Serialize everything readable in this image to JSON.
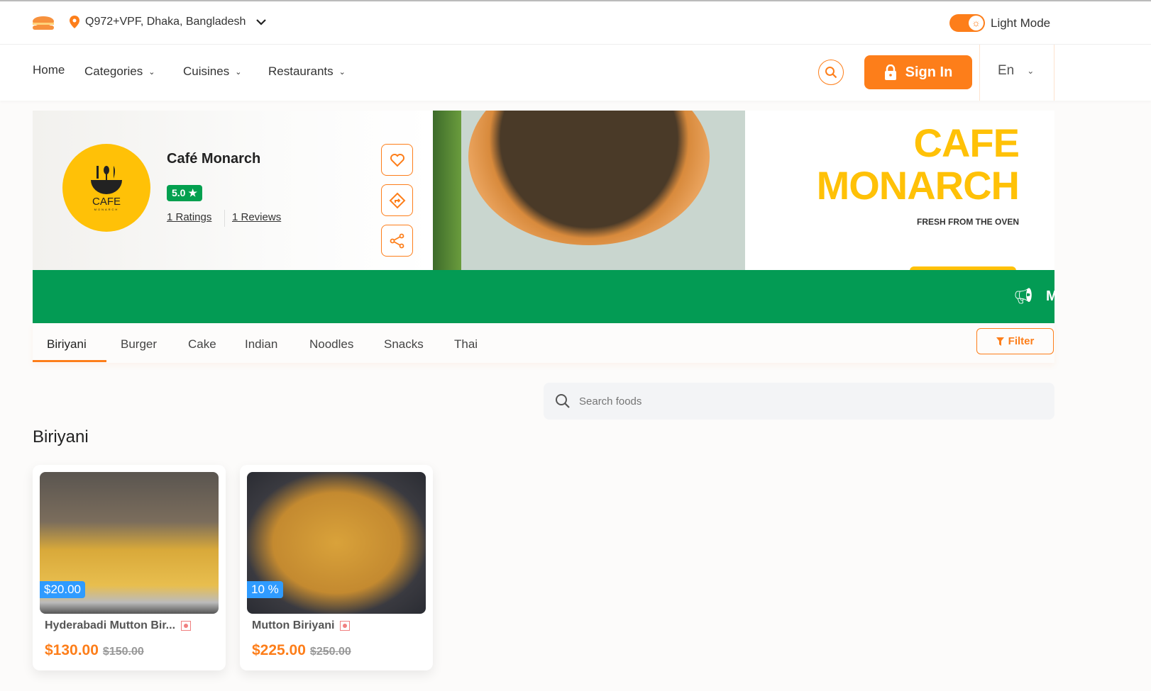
{
  "topbar": {
    "location": "Q972+VPF, Dhaka, Bangladesh",
    "theme_label": "Light Mode",
    "theme_on": true
  },
  "nav": {
    "home": "Home",
    "categories": "Categories",
    "cuisines": "Cuisines",
    "restaurants": "Restaurants",
    "sign_in": "Sign In",
    "language": "En"
  },
  "restaurant": {
    "name": "Café Monarch",
    "rating": "5.0 ★",
    "ratings_link": "1 Ratings",
    "reviews_link": "1 Reviews",
    "logo_text": "CAFE",
    "logo_subtext": "MONARCH"
  },
  "cover": {
    "title_line1": "CAFE",
    "title_line2": "MONARCH",
    "tagline": "FRESH FROM THE OVEN",
    "ticker": "M"
  },
  "tabs": [
    "Biriyani",
    "Burger",
    "Cake",
    "Indian",
    "Noodles",
    "Snacks",
    "Thai"
  ],
  "active_tab": "Biriyani",
  "filter_label": "Filter",
  "search": {
    "placeholder": "Search foods"
  },
  "section_title": "Biriyani",
  "foods": [
    {
      "name": "Hyderabadi Mutton Bir...",
      "badge": "$20.00",
      "price": "$130.00",
      "old_price": "$150.00"
    },
    {
      "name": "Mutton Biriyani",
      "badge": "10 %",
      "price": "$225.00",
      "old_price": "$250.00"
    }
  ],
  "colors": {
    "accent": "#fd7e1a",
    "green": "#039b54",
    "logo_yellow": "#ffc107",
    "badge_blue": "#2f9bff"
  }
}
